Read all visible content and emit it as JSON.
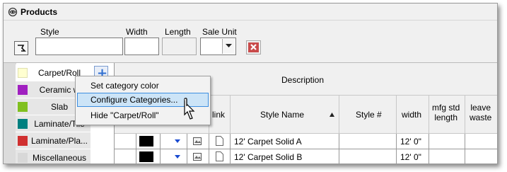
{
  "window": {
    "title": "Products"
  },
  "filters": {
    "style_label": "Style",
    "width_label": "Width",
    "length_label": "Length",
    "sale_unit_label": "Sale Unit",
    "style_value": "",
    "width_value": "",
    "length_value": "",
    "sale_unit_value": ""
  },
  "categories": [
    {
      "label": "Carpet/Roll",
      "color": "#ffffd0"
    },
    {
      "label": "Ceramic w",
      "color": "#a020c0"
    },
    {
      "label": "Slab",
      "color": "#80c020"
    },
    {
      "label": "Laminate/Tile",
      "color": "#008080"
    },
    {
      "label": "Laminate/Pla...",
      "color": "#d03030"
    },
    {
      "label": "Miscellaneous",
      "color": "#d8d8d8"
    }
  ],
  "context_menu": {
    "items": [
      {
        "label": "Set category color"
      },
      {
        "label": "Configure Categories..."
      },
      {
        "label": "Hide \"Carpet/Roll\""
      }
    ]
  },
  "table": {
    "group_header": "Description",
    "columns": {
      "link": "link",
      "style_name": "Style Name",
      "style_no": "Style #",
      "width": "width",
      "mfg_std_length": "mfg std\nlength",
      "leave_waste": "leave\nwaste"
    },
    "rows": [
      {
        "style_name": "12' Carpet Solid A",
        "width": "12' 0\""
      },
      {
        "style_name": "12' Carpet Solid B",
        "width": "12' 0\""
      },
      {
        "style_name": "",
        "width": ""
      }
    ]
  },
  "icons": {
    "title": "products-icon",
    "pin": "pin-icon",
    "clear": "red-x-icon",
    "add": "plus-icon",
    "sort": "sort-ascending-icon"
  }
}
